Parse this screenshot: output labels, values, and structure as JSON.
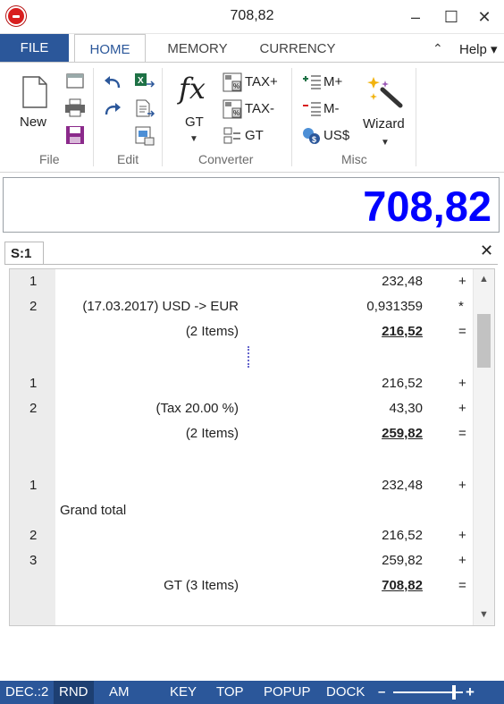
{
  "window": {
    "title": "708,82",
    "minimize": "–",
    "maximize": "☐",
    "close": "✕"
  },
  "tabs": {
    "file": "FILE",
    "items": [
      {
        "label": "HOME"
      },
      {
        "label": "MEMORY"
      },
      {
        "label": "CURRENCY"
      }
    ],
    "collapse": "⌃",
    "help": "Help ▾"
  },
  "ribbon": {
    "file": {
      "new_label": "New",
      "group_label": "File"
    },
    "edit": {
      "group_label": "Edit"
    },
    "converter": {
      "gt_label": "GT",
      "tax_plus": "TAX+",
      "tax_minus": "TAX-",
      "gt_small": "GT",
      "group_label": "Converter"
    },
    "misc": {
      "m_plus": "M+",
      "m_minus": "M-",
      "usd": "US$",
      "wizard": "Wizard",
      "group_label": "Misc"
    }
  },
  "display": {
    "value": "708,82"
  },
  "sheet": {
    "tab_label": "S:1",
    "close": "✕"
  },
  "tape": {
    "rows": [
      {
        "num": "1",
        "label": "",
        "value": "232,48",
        "op": "+",
        "total": false
      },
      {
        "num": "2",
        "label": "(17.03.2017) USD -> EUR",
        "value": "0,931359",
        "op": "*",
        "total": false
      },
      {
        "num": "",
        "label": "(2 Items)",
        "value": "216,52",
        "op": "=",
        "total": true
      },
      {
        "num": "1",
        "label": "",
        "value": "216,52",
        "op": "+",
        "total": false
      },
      {
        "num": "2",
        "label": "(Tax 20.00 %)",
        "value": "43,30",
        "op": "+",
        "total": false
      },
      {
        "num": "",
        "label": "(2 Items)",
        "value": "259,82",
        "op": "=",
        "total": true
      },
      {
        "num": "1",
        "label": "",
        "value": "232,48",
        "op": "+",
        "total": false
      },
      {
        "num": "",
        "label": "Grand total",
        "value": "",
        "op": "",
        "total": false
      },
      {
        "num": "2",
        "label": "",
        "value": "216,52",
        "op": "+",
        "total": false
      },
      {
        "num": "3",
        "label": "",
        "value": "259,82",
        "op": "+",
        "total": false
      },
      {
        "num": "",
        "label": "GT (3 Items)",
        "value": "708,82",
        "op": "=",
        "total": true
      }
    ]
  },
  "status": {
    "items": [
      {
        "label": "DEC.:2"
      },
      {
        "label": "RND"
      },
      {
        "label": "AM"
      },
      {
        "label": "KEY"
      },
      {
        "label": "TOP"
      },
      {
        "label": "POPUP"
      },
      {
        "label": "DOCK"
      }
    ],
    "zoom_minus": "–",
    "zoom_plus": "+"
  },
  "colors": {
    "accent": "#2b579a",
    "display_value": "#0000ff",
    "app_icon": "#d81e1e"
  }
}
